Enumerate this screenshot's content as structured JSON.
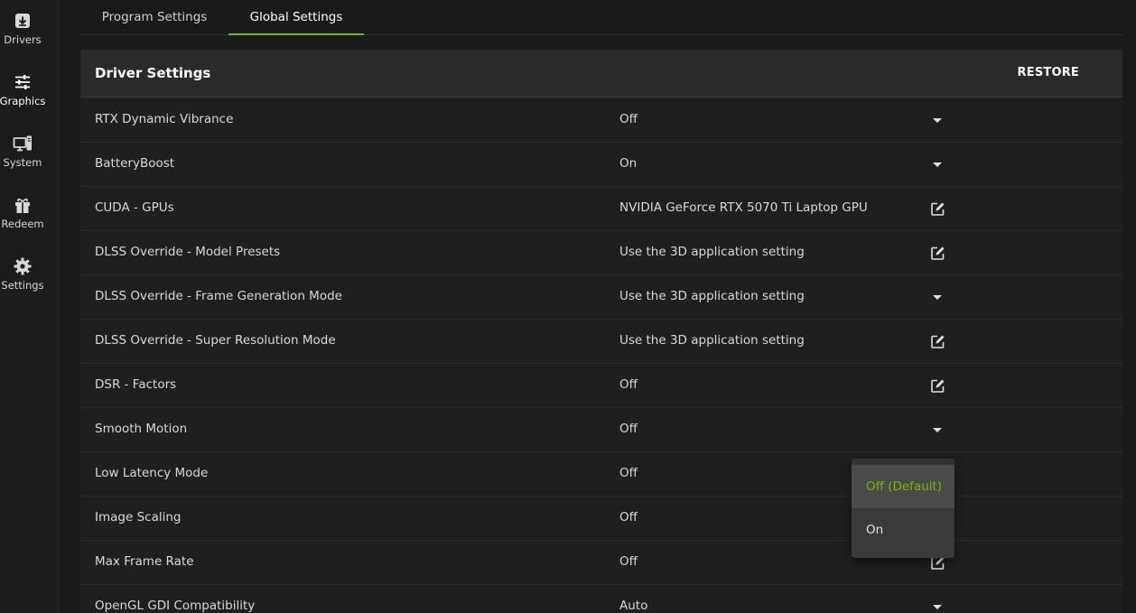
{
  "sidebar": {
    "items": [
      {
        "label": "Drivers",
        "icon": "drivers-download-icon"
      },
      {
        "label": "Graphics",
        "icon": "graphics-sliders-icon"
      },
      {
        "label": "System",
        "icon": "system-monitor-icon"
      },
      {
        "label": "Redeem",
        "icon": "redeem-gift-icon"
      },
      {
        "label": "Settings",
        "icon": "settings-gear-icon"
      }
    ],
    "active": "Graphics"
  },
  "tabs": [
    {
      "label": "Program Settings"
    },
    {
      "label": "Global Settings"
    }
  ],
  "active_tab": "Global Settings",
  "panel": {
    "title": "Driver Settings",
    "restore_label": "RESTORE",
    "rows": [
      {
        "label": "RTX Dynamic Vibrance",
        "value": "Off",
        "control": "dropdown"
      },
      {
        "label": "BatteryBoost",
        "value": "On",
        "control": "dropdown"
      },
      {
        "label": "CUDA - GPUs",
        "value": "NVIDIA GeForce RTX 5070 Ti Laptop GPU",
        "control": "edit"
      },
      {
        "label": "DLSS Override - Model Presets",
        "value": "Use the 3D application setting",
        "control": "edit"
      },
      {
        "label": "DLSS Override - Frame Generation Mode",
        "value": "Use the 3D application setting",
        "control": "dropdown"
      },
      {
        "label": "DLSS Override - Super Resolution Mode",
        "value": "Use the 3D application setting",
        "control": "edit"
      },
      {
        "label": "DSR - Factors",
        "value": "Off",
        "control": "edit"
      },
      {
        "label": "Smooth Motion",
        "value": "Off",
        "control": "dropdown"
      },
      {
        "label": "Low Latency Mode",
        "value": "Off",
        "control": "dropdown"
      },
      {
        "label": "Image Scaling",
        "value": "Off",
        "control": "edit"
      },
      {
        "label": "Max Frame Rate",
        "value": "Off",
        "control": "edit"
      },
      {
        "label": "OpenGL GDI Compatibility",
        "value": "Auto",
        "control": "dropdown"
      }
    ]
  },
  "dropdown": {
    "options": [
      {
        "label": "Off (Default)",
        "selected": true
      },
      {
        "label": "On",
        "selected": false
      }
    ]
  },
  "colors": {
    "accent": "#76b900",
    "background": "#1a1a1a",
    "panel_header": "#2a2a2a",
    "dropdown_bg": "#3a3a3a"
  }
}
